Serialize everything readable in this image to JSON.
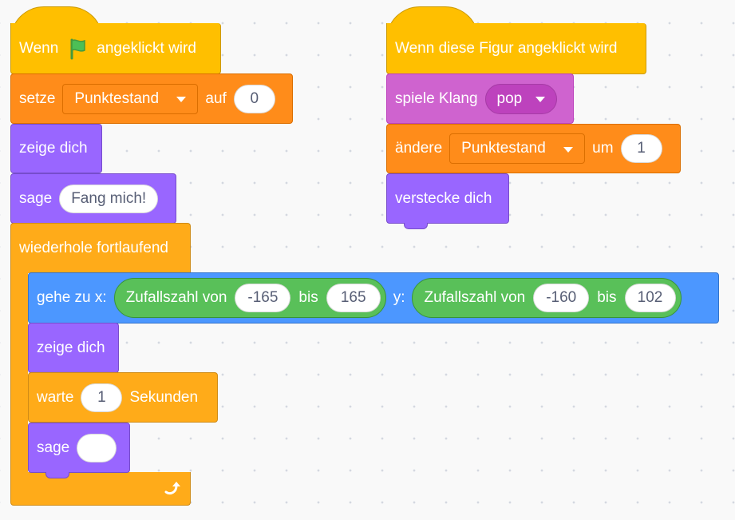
{
  "script1": {
    "hat": {
      "pre": "Wenn",
      "post": "angeklickt wird",
      "icon": "green-flag-icon"
    },
    "set_var": {
      "label": "setze",
      "variable": "Punktestand",
      "to_label": "auf",
      "value": "0"
    },
    "show1": {
      "label": "zeige dich"
    },
    "say1": {
      "label": "sage",
      "text": "Fang mich!"
    },
    "forever": {
      "label": "wiederhole fortlaufend",
      "icon": "loop-arrow-icon"
    },
    "goto": {
      "label": "gehe zu x:",
      "x_rand": {
        "label": "Zufallszahl von",
        "from": "-165",
        "to_label": "bis",
        "to": "165"
      },
      "y_label": "y:",
      "y_rand": {
        "label": "Zufallszahl von",
        "from": "-160",
        "to_label": "bis",
        "to": "102"
      }
    },
    "show2": {
      "label": "zeige dich"
    },
    "wait": {
      "label": "warte",
      "value": "1",
      "unit": "Sekunden"
    },
    "say2": {
      "label": "sage",
      "text": ""
    }
  },
  "script2": {
    "hat": {
      "label": "Wenn diese Figur angeklickt wird"
    },
    "play_sound": {
      "label": "spiele Klang",
      "sound": "pop"
    },
    "change_var": {
      "label": "ändere",
      "variable": "Punktestand",
      "by_label": "um",
      "value": "1"
    },
    "hide": {
      "label": "verstecke dich"
    }
  },
  "colors": {
    "events": "#ffbf00",
    "variables": "#ff8c1a",
    "looks": "#9966ff",
    "sound": "#cf63cf",
    "control": "#ffab19",
    "motion": "#4c97ff",
    "operators": "#59c059"
  }
}
